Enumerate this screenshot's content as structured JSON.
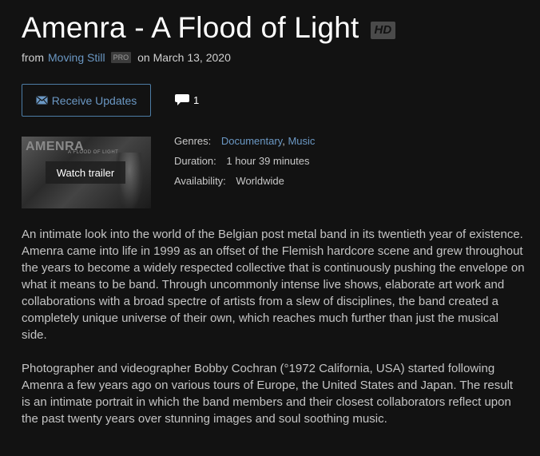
{
  "header": {
    "title": "Amenra - A Flood of Light",
    "hd_badge": "HD",
    "byline_from": "from",
    "creator": "Moving Still",
    "pro_badge": "PRO",
    "date": "on March 13, 2020"
  },
  "actions": {
    "receive_updates_label": "Receive Updates",
    "comment_count": "1"
  },
  "trailer": {
    "thumb_band": "AMENRA",
    "thumb_subtitle": "A FLOOD OF LIGHT",
    "watch_label": "Watch trailer"
  },
  "meta": {
    "genres_label": "Genres:",
    "genres": [
      "Documentary",
      "Music"
    ],
    "genre_separator": ",",
    "duration_label": "Duration:",
    "duration": "1 hour 39 minutes",
    "availability_label": "Availability:",
    "availability": "Worldwide"
  },
  "description": [
    "An intimate look into the world of the Belgian post metal band in its twentieth year of existence. Amenra came into life in 1999 as an offset of the Flemish hardcore scene and grew throughout the years to become a widely respected collective that is continuously pushing the envelope on what it means to be band. Through uncommonly intense live shows, elaborate art work and collaborations with a broad spectre of artists from a slew of disciplines, the band created a completely unique universe of their own, which reaches much further than just the musical side.",
    "Photographer and videographer Bobby Cochran (°1972 California, USA) started following Amenra a few years ago on various tours of Europe, the United States and Japan. The result is an intimate portrait in which the band members and their closest collaborators reflect upon the past twenty years over stunning images and soul soothing music."
  ],
  "colors": {
    "background": "#121212",
    "link": "#6b98c4",
    "button_border": "#4d7da6",
    "text": "#c4c4c4"
  },
  "icons": {
    "envelope": "envelope-icon",
    "comment": "comment-bubble-icon"
  }
}
